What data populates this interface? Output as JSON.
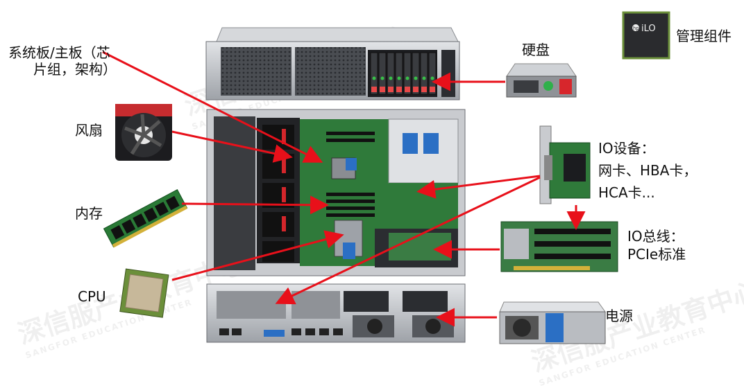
{
  "labels": {
    "motherboard_line1": "系统板/主板（芯",
    "motherboard_line2": "片组，架构）",
    "fan": "风扇",
    "memory": "内存",
    "cpu": "CPU",
    "disk": "硬盘",
    "mgmt": "管理组件",
    "io_dev_title": "IO设备：",
    "io_dev_line1": "网卡、HBA卡，",
    "io_dev_line2": "HCA卡...",
    "io_bus_title": "IO总线：",
    "io_bus_line2": "PCIe标准",
    "psu": "电源"
  },
  "chip": {
    "logo": "hp",
    "text": "iLO"
  },
  "watermark": {
    "cn": "深信服产业教育中心",
    "en": "SANGFOR EDUCATION CENTER"
  },
  "colors": {
    "arrow": "#e8101a",
    "board": "#2f7a3a",
    "chassis": "#b9bcc1",
    "dark": "#1f1f22"
  }
}
